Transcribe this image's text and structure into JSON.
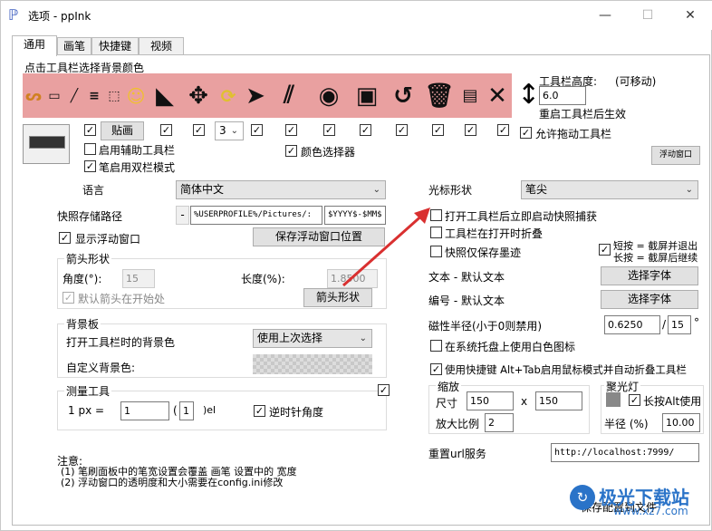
{
  "window": {
    "title": "选项 - ppInk",
    "minimize": "—",
    "maximize": "☐",
    "close": "✕"
  },
  "tabs": [
    "通用",
    "画笔",
    "快捷键",
    "视频"
  ],
  "toolbar_section": {
    "heading": "点击工具栏选择背景颜色",
    "height_label": "工具栏高度:",
    "movable": "(可移动)",
    "height_value": "6.0",
    "restart_note": "重启工具栏后生效",
    "allow_drag": "允许拖动工具栏",
    "float_window_btn": "浮动窗口",
    "paste_btn": "贴画",
    "count_value": "3",
    "enable_aux": "启用辅助工具栏",
    "pen_dual": "笔启用双栏模式",
    "color_picker": "颜色选择器"
  },
  "language": {
    "label": "语言",
    "value": "简体中文"
  },
  "cursor": {
    "label": "光标形状",
    "value": "笔尖"
  },
  "snapshot": {
    "label": "快照存储路径",
    "path": "%USERPROFILE%/Pictures/:",
    "pattern": "$YYYY$-$MM$"
  },
  "float_window": {
    "show": "显示浮动窗口",
    "save_pos": "保存浮动窗口位置"
  },
  "arrow": {
    "group": "箭头形状",
    "angle_label": "角度(°):",
    "angle_value": "15",
    "length_label": "长度(%):",
    "length_value": "1.8500",
    "default_start": "默认箭头在开始处",
    "shape_btn": "箭头形状"
  },
  "background": {
    "group": "背景板",
    "open_label": "打开工具栏时的背景色",
    "open_value": "使用上次选择",
    "custom_label": "自定义背景色:"
  },
  "measure": {
    "group": "测量工具",
    "px_label": "1 px =",
    "px_value": "1",
    "paren_open": "(",
    "num": "1",
    "unit": ")el",
    "ccw": "逆时针角度"
  },
  "notes": {
    "title": "注意:",
    "line1": "(1) 笔刷面板中的笔宽设置会覆盖 画笔 设置中的 宽度",
    "line2": "(2) 浮动窗口的透明度和大小需要在config.ini修改"
  },
  "right_options": {
    "snap_on_open": "打开工具栏后立即启动快照捕获",
    "fold_on_open": "工具栏在打开时折叠",
    "snap_save_ink": "快照仅保存墨迹",
    "short_press": "短按 = 截屏并退出",
    "long_press": "长按 = 截屏后继续",
    "text_label": "文本 - 默认文本",
    "text_btn": "选择字体",
    "num_label": "编号 - 默认文本",
    "num_btn": "选择字体",
    "magnet_label": "磁性半径(小于0则禁用)",
    "magnet_value": "0.6250",
    "magnet_slash": "/",
    "magnet_deg": "15",
    "degree": "°",
    "tray_white": "在系统托盘上使用白色图标",
    "alt_tab": "使用快捷键 Alt+Tab启用鼠标模式并自动折叠工具栏"
  },
  "zoom": {
    "group": "缩放",
    "size_label": "尺寸",
    "w": "150",
    "x": "x",
    "h": "150",
    "ratio_label": "放大比例",
    "ratio": "2"
  },
  "spotlight": {
    "group": "聚光灯",
    "long_alt": "长按Alt使用",
    "radius_label": "半径 (%)",
    "radius": "10.00"
  },
  "url": {
    "label": "重置url服务",
    "value": "http://localhost:7999/"
  },
  "save_config": "保存配置到文件",
  "watermark": {
    "line1": "极光下载站",
    "line2": "www.xz7.com"
  },
  "colors": {
    "toolbar_bg": "#e9a0a0",
    "arrow_red": "#d93030"
  }
}
